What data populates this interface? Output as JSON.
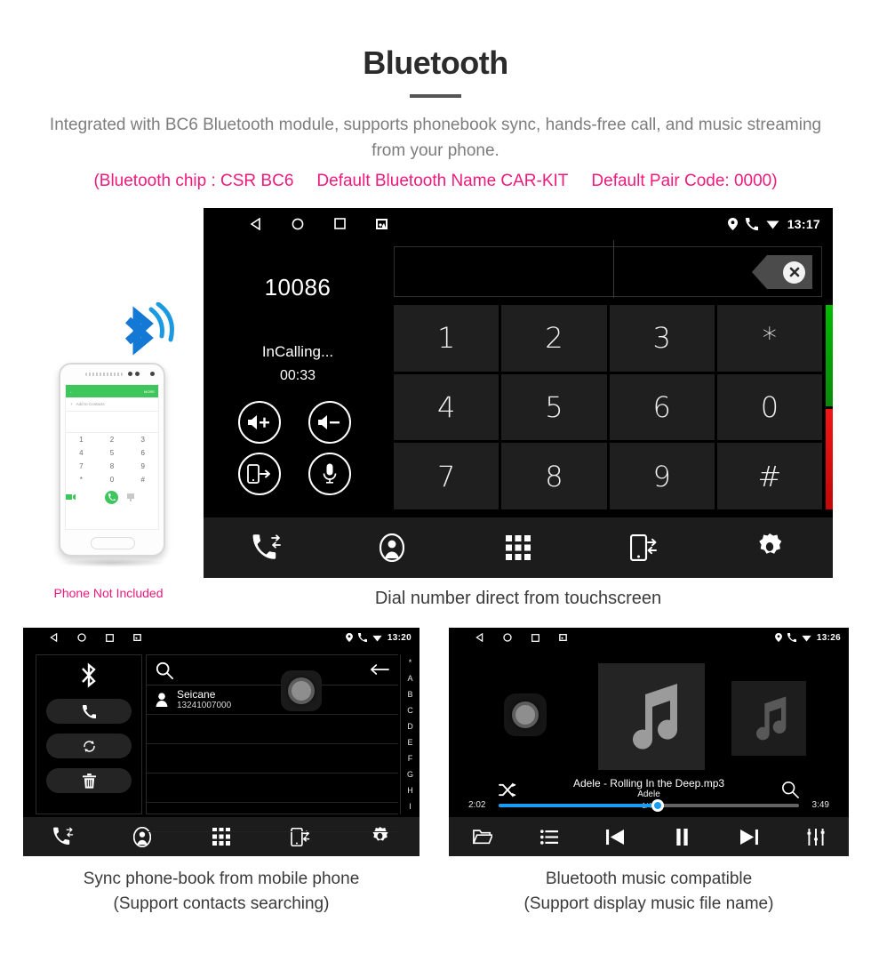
{
  "header": {
    "title": "Bluetooth",
    "description": "Integrated with BC6 Bluetooth module, supports phonebook sync, hands-free call, and music streaming from your phone.",
    "spec_chip": "(Bluetooth chip : CSR BC6",
    "spec_name": "Default Bluetooth Name CAR-KIT",
    "spec_pair": "Default Pair Code: 0000)",
    "accent_color": "#f0197c",
    "text_color": "#7d7d7d"
  },
  "phone_illustration": {
    "caption": "Phone Not Included",
    "bluetooth_icon": "bluetooth-wave-icon",
    "screen": {
      "back_label": "",
      "more_label": "MORE",
      "add_contact_label": "Add to Contacts",
      "keys": [
        "1",
        "2",
        "3",
        "4",
        "5",
        "6",
        "7",
        "8",
        "9",
        "*",
        "0",
        "#"
      ]
    }
  },
  "main_screenshot": {
    "caption": "Dial number direct from touchscreen",
    "statusbar": {
      "time": "13:17",
      "nav_icons": [
        "back-icon",
        "home-icon",
        "recents-icon",
        "screenshot-icon"
      ],
      "status_icons": [
        "location-icon",
        "phone-icon",
        "wifi-icon"
      ]
    },
    "call": {
      "number": "10086",
      "state": "InCalling...",
      "timer": "00:33",
      "controls": [
        {
          "name": "volume-up-button",
          "icon": "speaker-plus-icon"
        },
        {
          "name": "volume-down-button",
          "icon": "speaker-minus-icon"
        },
        {
          "name": "transfer-to-phone-button",
          "icon": "phone-transfer-icon"
        },
        {
          "name": "mute-button",
          "icon": "microphone-icon"
        }
      ]
    },
    "entry": {
      "value": "",
      "backspace_icon": "backspace-icon"
    },
    "keypad": [
      "1",
      "2",
      "3",
      "*",
      "4",
      "5",
      "6",
      "0",
      "7",
      "8",
      "9",
      "#"
    ],
    "answer_button": "answer-call-icon",
    "hangup_button": "end-call-icon",
    "answer_color": "#00bb00",
    "hangup_color": "#f21515",
    "navbar": [
      "call-log-icon",
      "contacts-icon",
      "dialpad-icon",
      "sync-device-icon",
      "settings-icon"
    ]
  },
  "phonebook_screenshot": {
    "caption_line1": "Sync phone-book from mobile phone",
    "caption_line2": "(Support contacts searching)",
    "statusbar": {
      "time": "13:20"
    },
    "sidebar": [
      {
        "name": "bluetooth-status-icon",
        "icon": "bluetooth-icon"
      },
      {
        "name": "dial-button",
        "icon": "phone-icon"
      },
      {
        "name": "sync-contacts-button",
        "icon": "refresh-icon"
      },
      {
        "name": "delete-contacts-button",
        "icon": "trash-icon"
      }
    ],
    "search_placeholder": "",
    "back_icon": "arrow-left-icon",
    "contacts": [
      {
        "name": "Seicane",
        "phone": "13241007000"
      }
    ],
    "index": [
      "*",
      "A",
      "B",
      "C",
      "D",
      "E",
      "F",
      "G",
      "H",
      "I"
    ],
    "navbar": [
      "call-log-icon",
      "contacts-icon",
      "dialpad-icon",
      "sync-device-icon",
      "settings-icon"
    ]
  },
  "music_screenshot": {
    "caption_line1": "Bluetooth music compatible",
    "caption_line2": "(Support display music file name)",
    "statusbar": {
      "time": "13:26"
    },
    "track_title": "Adele - Rolling In the Deep.mp3",
    "artist": "Adele",
    "track_count": "1/48",
    "elapsed": "2:02",
    "duration": "3:49",
    "progress_percent": 53,
    "progress_color": "#1a9cf0",
    "shuffle_icon": "shuffle-icon",
    "search_icon": "search-icon",
    "navbar": [
      "folder-icon",
      "playlist-icon",
      "previous-icon",
      "pause-icon",
      "next-icon",
      "equalizer-icon"
    ]
  }
}
